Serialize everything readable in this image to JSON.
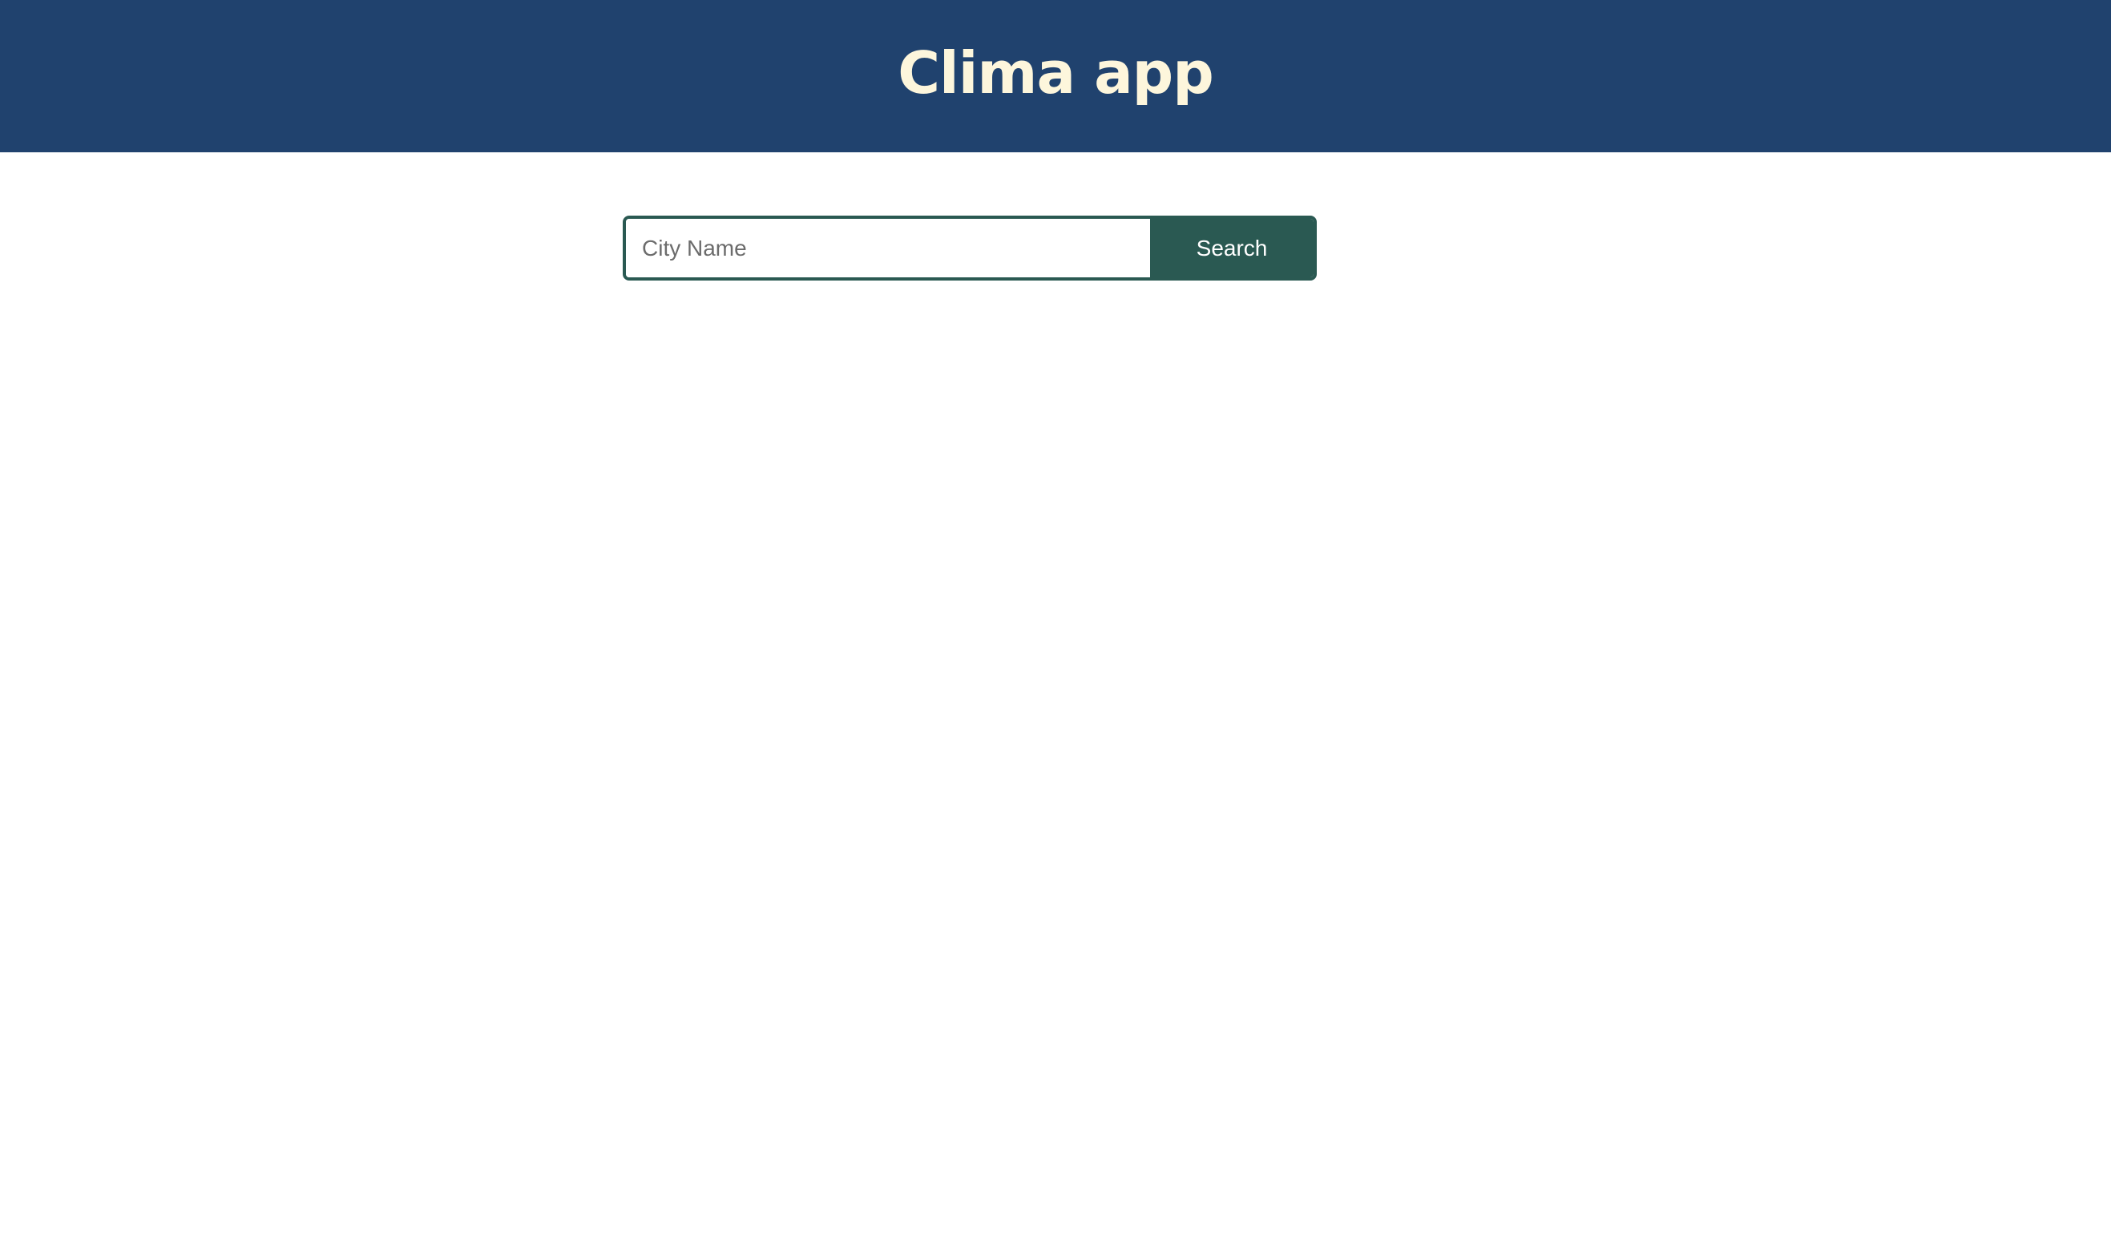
{
  "header": {
    "title": "Clima app"
  },
  "search": {
    "placeholder": "City Name",
    "value": "",
    "button_label": "Search"
  },
  "colors": {
    "header_background": "#20426e",
    "title_text": "#fdf6dc",
    "accent": "#2a5952",
    "page_background": "#ffffff"
  }
}
